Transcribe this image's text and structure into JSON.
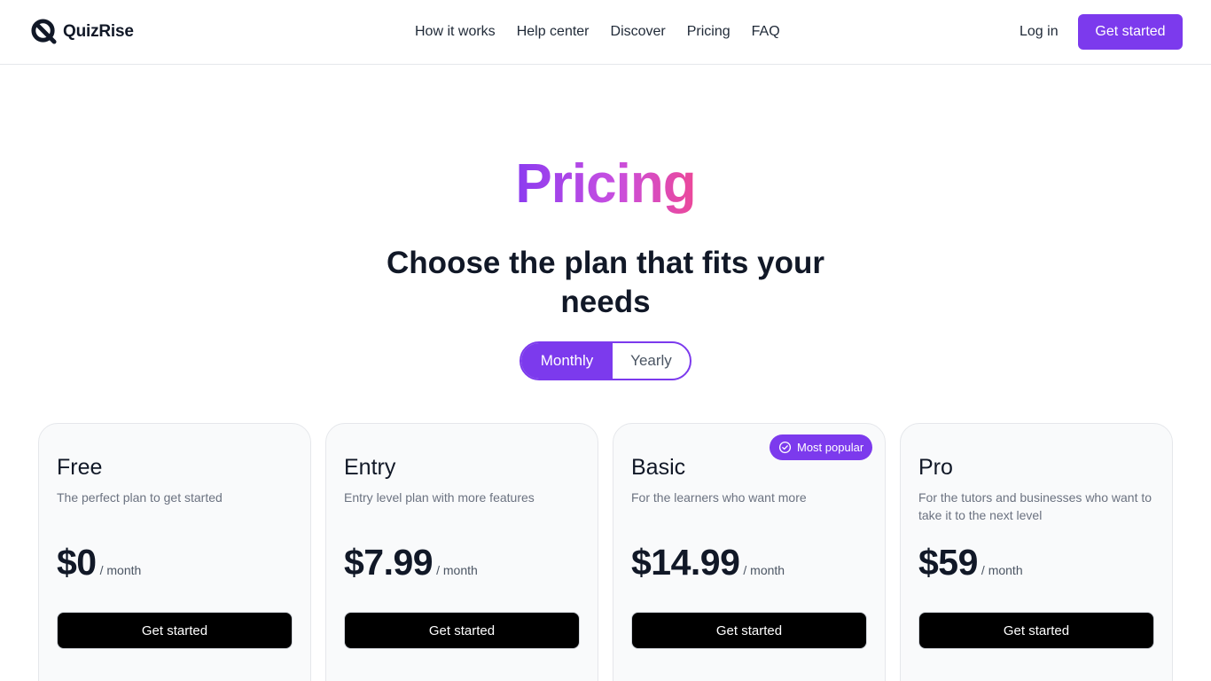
{
  "brand": {
    "name": "QuizRise",
    "icon": "quizrise-logo-icon"
  },
  "nav": {
    "links": [
      "How it works",
      "Help center",
      "Discover",
      "Pricing",
      "FAQ"
    ],
    "login_label": "Log in",
    "cta_label": "Get started"
  },
  "hero": {
    "title": "Pricing",
    "subtitle": "Choose the plan that fits your needs"
  },
  "billing_toggle": {
    "options": [
      "Monthly",
      "Yearly"
    ],
    "selected": "Monthly"
  },
  "plans": [
    {
      "name": "Free",
      "description": "The perfect plan to get started",
      "price": "$0",
      "period": "/ month",
      "button": "Get started"
    },
    {
      "name": "Entry",
      "description": "Entry level plan with more features",
      "price": "$7.99",
      "period": "/ month",
      "button": "Get started"
    },
    {
      "name": "Basic",
      "description": "For the learners who want more",
      "price": "$14.99",
      "period": "/ month",
      "button": "Get started",
      "badge": "Most popular",
      "badge_icon": "check-circle-icon"
    },
    {
      "name": "Pro",
      "description": "For the tutors and businesses who want to take it to the next level",
      "price": "$59",
      "period": "/ month",
      "button": "Get started"
    }
  ],
  "colors": {
    "accent": "#7c3aed",
    "gradient_start": "#8b3bf0",
    "gradient_end": "#ec4899",
    "card_bg": "#f9fafb",
    "button_dark": "#000000"
  }
}
